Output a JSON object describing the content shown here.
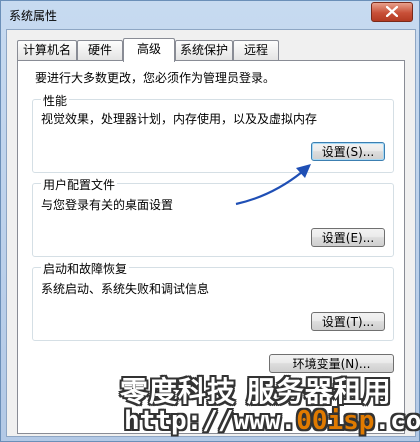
{
  "window": {
    "title": "系统属性"
  },
  "tabs": [
    {
      "label": "计算机名"
    },
    {
      "label": "硬件"
    },
    {
      "label": "高级"
    },
    {
      "label": "系统保护"
    },
    {
      "label": "远程"
    }
  ],
  "active_tab": "高级",
  "admin_note": "要进行大多数更改，您必须作为管理员登录。",
  "groups": {
    "performance": {
      "title": "性能",
      "desc": "视觉效果，处理器计划，内存使用，以及及虚拟内存",
      "button": "设置(S)..."
    },
    "user_profiles": {
      "title": "用户配置文件",
      "desc": "与您登录有关的桌面设置",
      "button": "设置(E)..."
    },
    "startup_recovery": {
      "title": "启动和故障恢复",
      "desc": "系统启动、系统失败和调试信息",
      "button": "设置(T)..."
    }
  },
  "env_button": "环境变量(N)...",
  "watermark": {
    "line1": "零度科技 服务器租用",
    "line2_prefix": "http://www.",
    "line2_highlight": "00isp",
    "line2_suffix": ".com"
  },
  "colors": {
    "arrow": "#1f4fb5",
    "accent_border": "#3c7fb1"
  }
}
